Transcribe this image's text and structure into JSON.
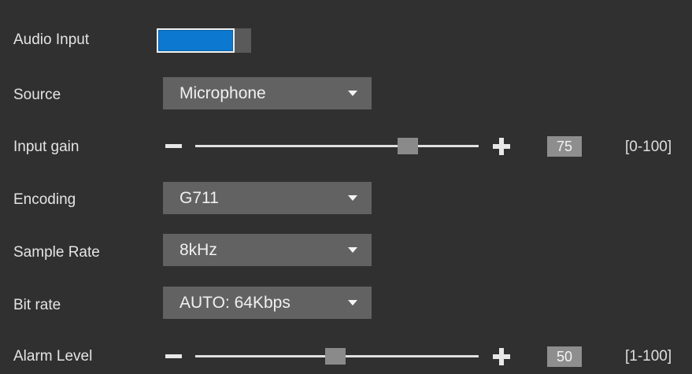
{
  "audio_input": {
    "label": "Audio Input",
    "enabled": true,
    "accent_color": "#0c78cf"
  },
  "source": {
    "label": "Source",
    "value": "Microphone"
  },
  "input_gain": {
    "label": "Input gain",
    "value": "75",
    "level": 75,
    "range": "[0-100]"
  },
  "encoding": {
    "label": "Encoding",
    "value": "G711"
  },
  "sample_rate": {
    "label": "Sample Rate",
    "value": "8kHz"
  },
  "bit_rate": {
    "label": "Bit rate",
    "value": "AUTO: 64Kbps"
  },
  "alarm_level": {
    "label": "Alarm Level",
    "value": "50",
    "level": 50,
    "range": "[1-100]"
  },
  "icons": {
    "decrease": "minus-icon",
    "increase": "plus-icon",
    "dropdown": "caret-down-icon"
  }
}
